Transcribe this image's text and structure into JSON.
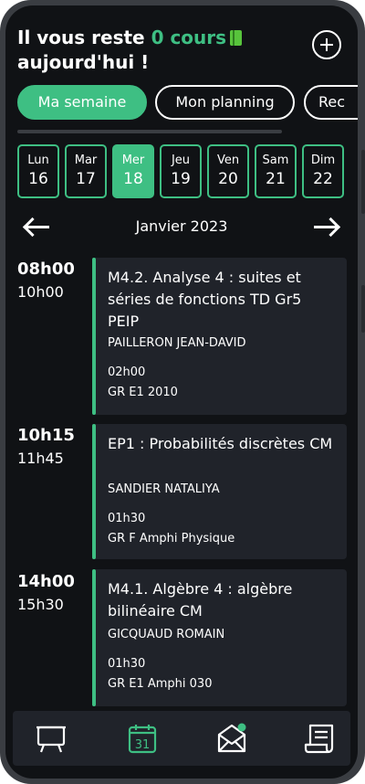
{
  "header": {
    "title_prefix": "Il vous reste ",
    "count_text": "0 cours",
    "title_suffix": "aujourd'hui !"
  },
  "tabs": [
    {
      "label": "Ma semaine",
      "active": true
    },
    {
      "label": "Mon planning",
      "active": false
    },
    {
      "label": "Rec",
      "active": false
    }
  ],
  "days": [
    {
      "name": "Lun",
      "num": "16"
    },
    {
      "name": "Mar",
      "num": "17"
    },
    {
      "name": "Mer",
      "num": "18"
    },
    {
      "name": "Jeu",
      "num": "19"
    },
    {
      "name": "Ven",
      "num": "20"
    },
    {
      "name": "Sam",
      "num": "21"
    },
    {
      "name": "Dim",
      "num": "22"
    }
  ],
  "selected_day": "Mer",
  "month": "Janvier 2023",
  "events": [
    {
      "start": "08h00",
      "end": "10h00",
      "title": "M4.2. Analyse 4 : suites et séries de fonctions TD Gr5 PEIP",
      "teacher": "PAILLERON JEAN-DAVID",
      "duration": "02h00",
      "room": "GR E1 2010"
    },
    {
      "start": "10h15",
      "end": "11h45",
      "title": "EP1 : Probabilités discrètes CM",
      "teacher": "SANDIER NATALIYA",
      "duration": "01h30",
      "room": "GR F Amphi Physique"
    },
    {
      "start": "14h00",
      "end": "15h30",
      "title": "M4.1. Algèbre 4 : algèbre bilinéaire CM",
      "teacher": "GICQUAUD ROMAIN",
      "duration": "01h30",
      "room": "GR E1 Amphi 030"
    }
  ],
  "bottom_nav": {
    "calendar_day": "31",
    "items": [
      "board-icon",
      "calendar-icon",
      "mail-icon",
      "document-icon"
    ]
  },
  "colors": {
    "accent": "#3ebf83",
    "background": "#101215",
    "card": "#20232a",
    "notification_dot": "#3ebf83"
  }
}
